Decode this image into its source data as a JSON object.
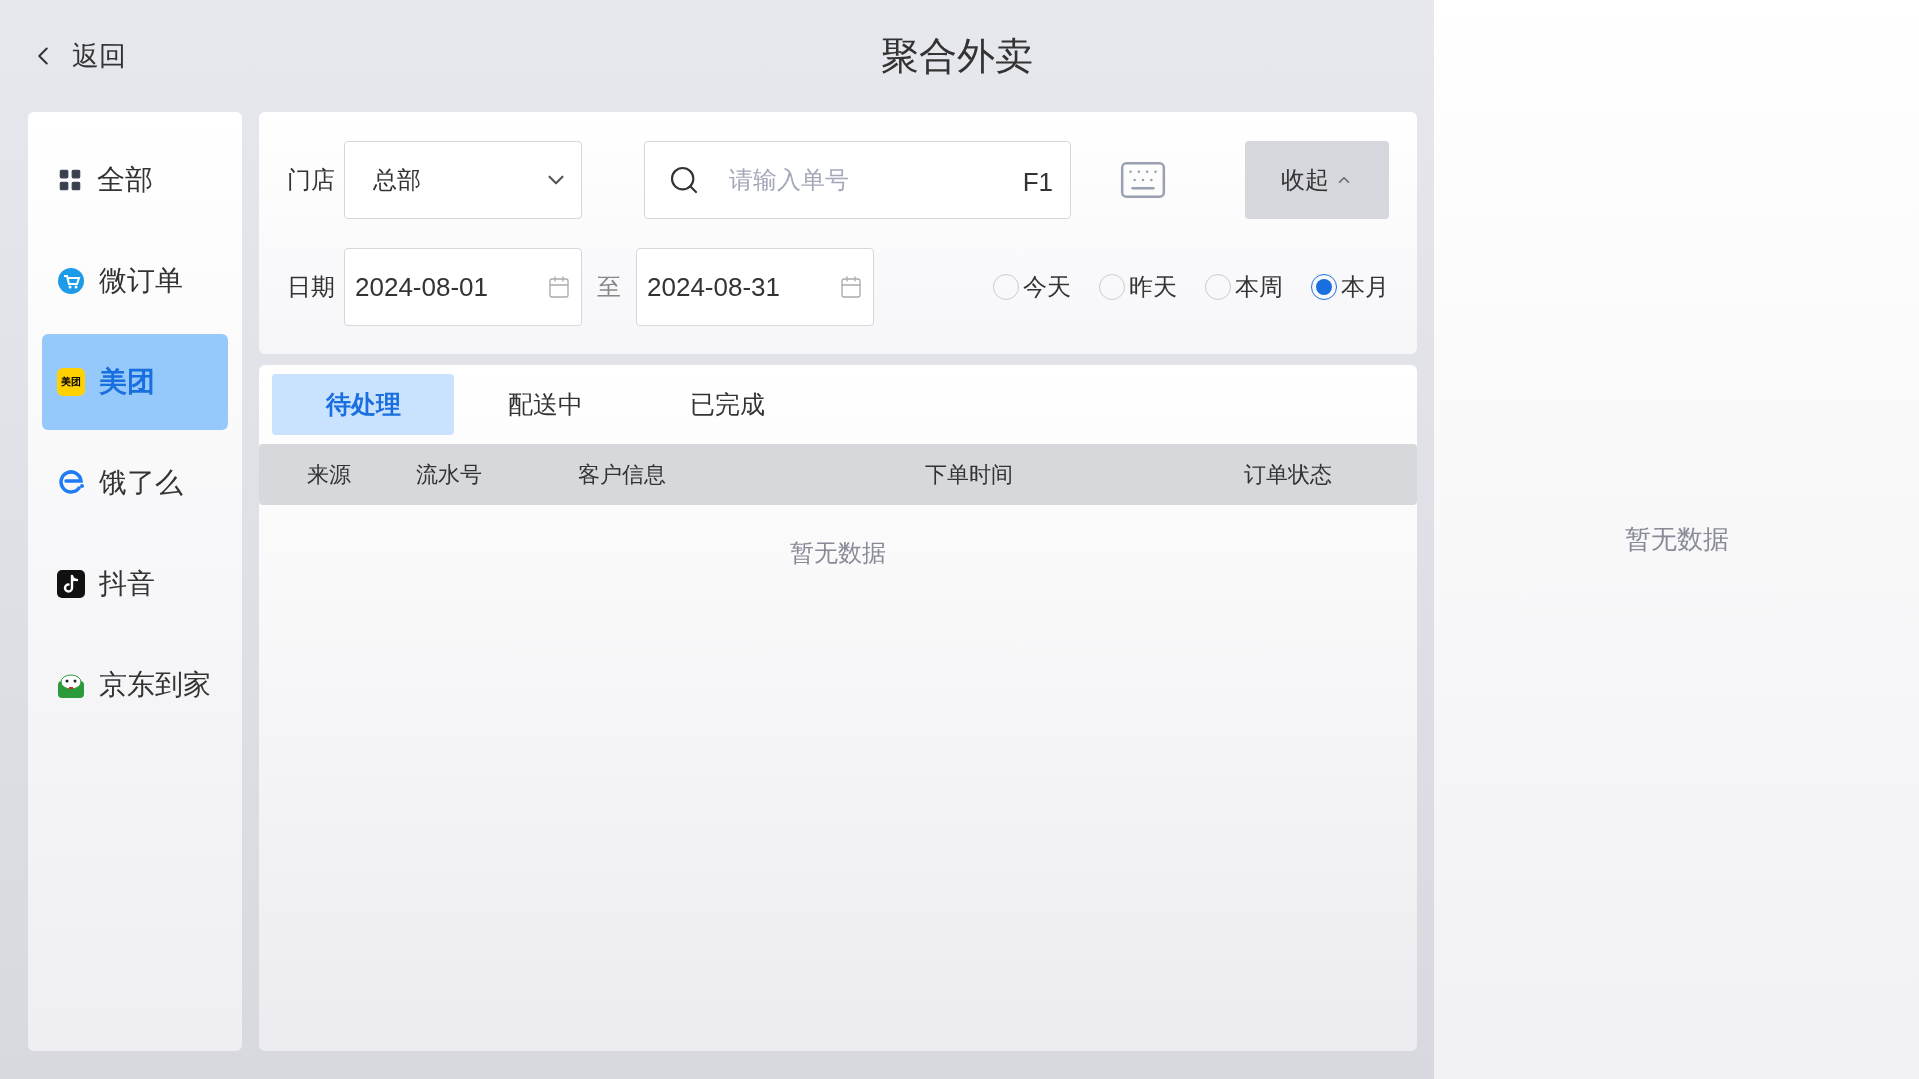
{
  "back": {
    "label": "返回"
  },
  "title": "聚合外卖",
  "sidebar": {
    "items": [
      {
        "kind": "grid",
        "label": "全部",
        "selected": false
      },
      {
        "kind": "cart",
        "label": "微订单",
        "selected": false
      },
      {
        "kind": "badge",
        "label": "美团",
        "badge": "美团",
        "selected": true
      },
      {
        "kind": "e",
        "label": "饿了么",
        "selected": false
      },
      {
        "kind": "note",
        "label": "抖音",
        "selected": false
      },
      {
        "kind": "jd",
        "label": "京东到家",
        "selected": false
      }
    ]
  },
  "filters": {
    "store_label": "门店",
    "store_value": "总部",
    "search": {
      "placeholder": "请输入单号",
      "shortcut": "F1"
    },
    "collapse": "收起",
    "date_label": "日期",
    "date_from": "2024-08-01",
    "date_sep": "至",
    "date_to": "2024-08-31",
    "ranges": [
      {
        "label": "今天",
        "selected": false
      },
      {
        "label": "昨天",
        "selected": false
      },
      {
        "label": "本周",
        "selected": false
      },
      {
        "label": "本月",
        "selected": true
      }
    ]
  },
  "tabs": [
    {
      "label": "待处理",
      "selected": true
    },
    {
      "label": "配送中",
      "selected": false
    },
    {
      "label": "已完成",
      "selected": false
    }
  ],
  "table": {
    "columns": [
      "来源",
      "流水号",
      "客户信息",
      "下单时间",
      "订单状态"
    ],
    "empty": "暂无数据"
  },
  "detail": {
    "empty": "暂无数据"
  }
}
